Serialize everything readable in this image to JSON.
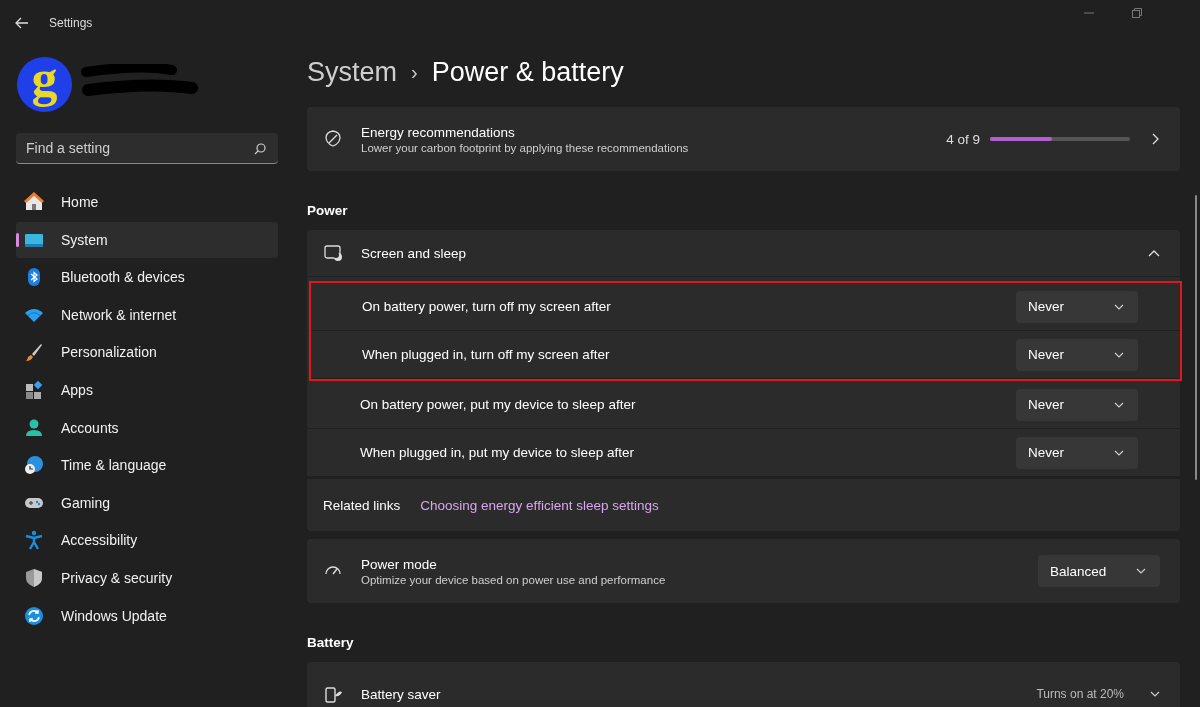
{
  "window": {
    "title": "Settings"
  },
  "account": {
    "avatar_letter": "g"
  },
  "search": {
    "placeholder": "Find a setting"
  },
  "nav": [
    {
      "label": "Home",
      "selected": false
    },
    {
      "label": "System",
      "selected": true
    },
    {
      "label": "Bluetooth & devices",
      "selected": false
    },
    {
      "label": "Network & internet",
      "selected": false
    },
    {
      "label": "Personalization",
      "selected": false
    },
    {
      "label": "Apps",
      "selected": false
    },
    {
      "label": "Accounts",
      "selected": false
    },
    {
      "label": "Time & language",
      "selected": false
    },
    {
      "label": "Gaming",
      "selected": false
    },
    {
      "label": "Accessibility",
      "selected": false
    },
    {
      "label": "Privacy & security",
      "selected": false
    },
    {
      "label": "Windows Update",
      "selected": false
    }
  ],
  "breadcrumb": {
    "parent": "System",
    "separator": "›",
    "current": "Power & battery"
  },
  "energy": {
    "title": "Energy recommendations",
    "subtitle": "Lower your carbon footprint by applying these recommendations",
    "count": "4 of 9",
    "level": 0.444
  },
  "power_section": {
    "heading": "Power",
    "screen_sleep": {
      "title": "Screen and sleep",
      "expanded": true,
      "rows": [
        {
          "label": "On battery power, turn off my screen after",
          "value": "Never",
          "highlighted": true
        },
        {
          "label": "When plugged in, turn off my screen after",
          "value": "Never",
          "highlighted": true
        },
        {
          "label": "On battery power, put my device to sleep after",
          "value": "Never",
          "highlighted": false
        },
        {
          "label": "When plugged in, put my device to sleep after",
          "value": "Never",
          "highlighted": false
        }
      ],
      "related_label": "Related links",
      "related_link": "Choosing energy efficient sleep settings"
    },
    "power_mode": {
      "title": "Power mode",
      "subtitle": "Optimize your device based on power use and performance",
      "value": "Balanced"
    }
  },
  "battery_section": {
    "heading": "Battery",
    "battery_saver": {
      "title": "Battery saver",
      "status": "Turns on at 20%"
    }
  }
}
